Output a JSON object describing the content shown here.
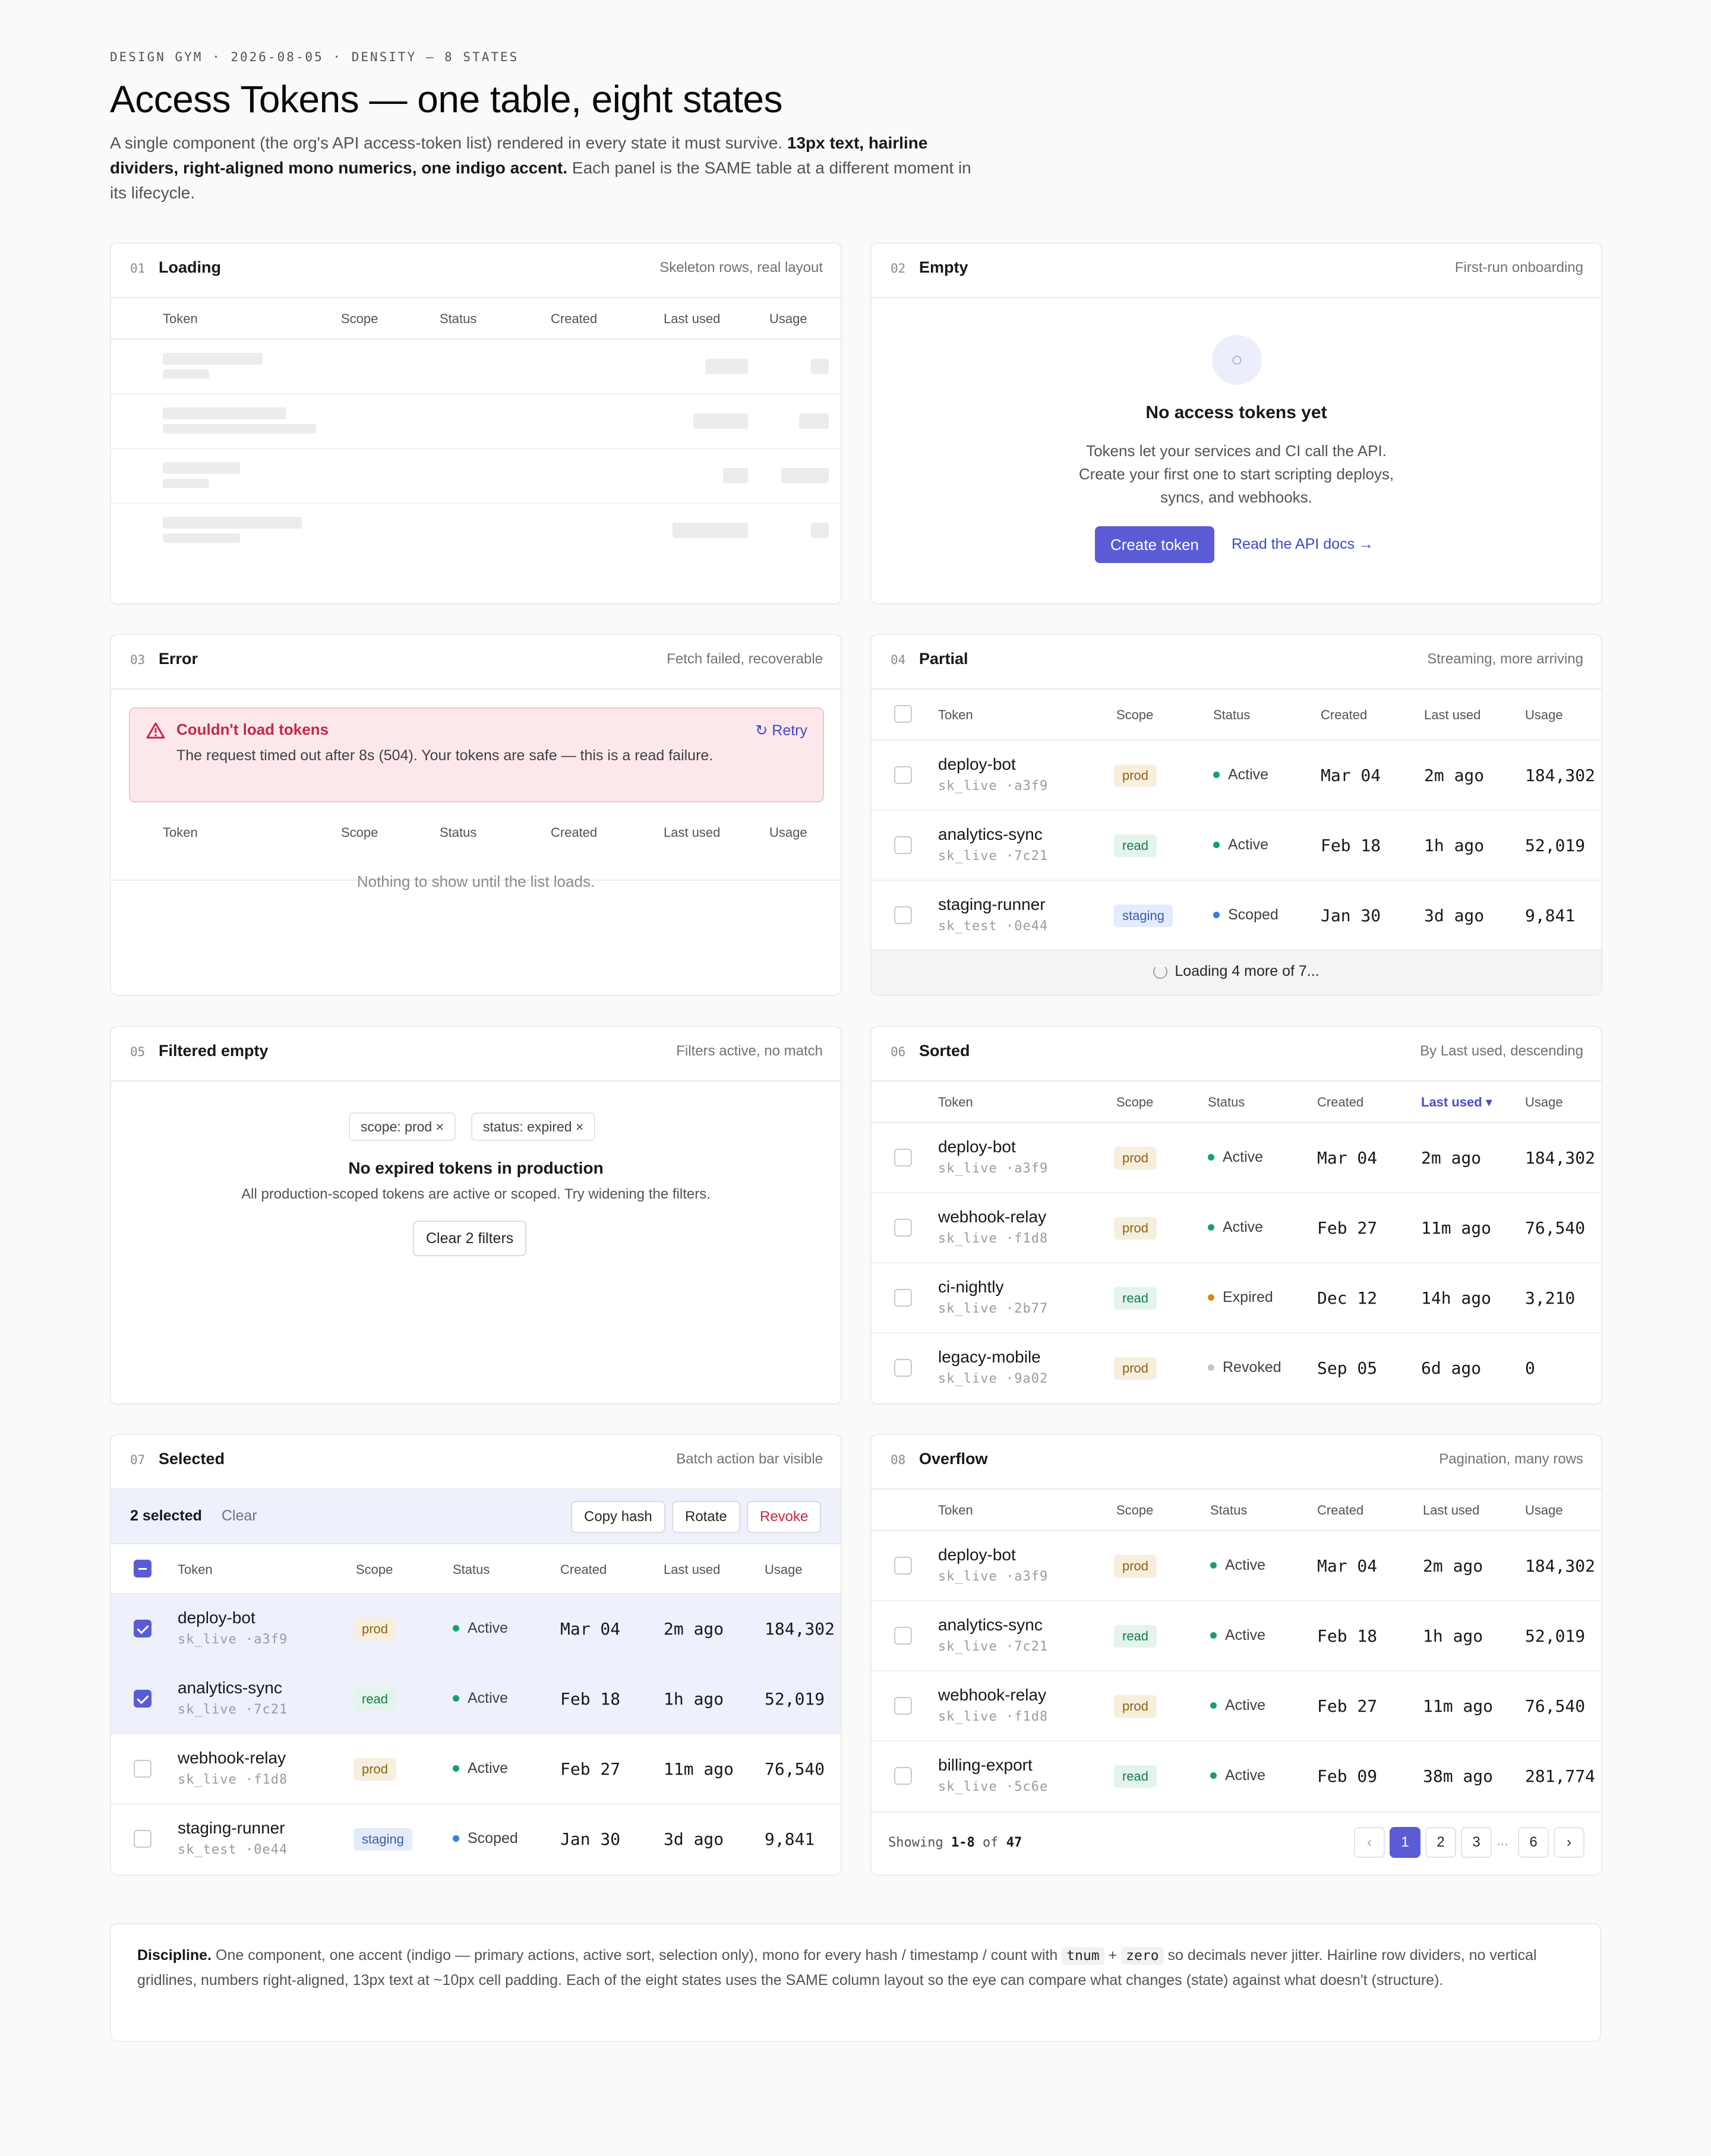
{
  "header": {
    "eyebrow": "DESIGN GYM · 2026-08-05 · DENSITY — 8 STATES",
    "title": "Access Tokens — one table, eight states",
    "intro_a": "A single component (the org's API access-token list) rendered in every state it must survive. ",
    "intro_b": "13px text, hairline dividers, right-aligned mono numerics, one indigo accent.",
    "intro_c": " Each panel is the SAME table at a different moment in its lifecycle."
  },
  "columns": {
    "token": "Token",
    "scope": "Scope",
    "status": "Status",
    "created": "Created",
    "last_used": "Last used",
    "usage": "Usage"
  },
  "panels": {
    "loading": {
      "num": "01",
      "name": "Loading",
      "sub": "Skeleton rows, real layout"
    },
    "empty": {
      "num": "02",
      "name": "Empty",
      "sub": "First-run onboarding",
      "icon": "◌",
      "title": "No access tokens yet",
      "body": [
        "Tokens let your services and CI call the API.",
        "Create your first one to start scripting deploys,",
        "syncs, and webhooks."
      ],
      "cta": "Create token",
      "link": "Read the API docs →"
    },
    "error": {
      "num": "03",
      "name": "Error",
      "sub": "Fetch failed, recoverable",
      "alert_title": "Couldn't load tokens",
      "alert_msg": "The request timed out after 8s (504). Your tokens are safe — this is a read failure.",
      "retry": "↻ Retry",
      "empty_msg": "Nothing to show until the list loads."
    },
    "partial": {
      "num": "04",
      "name": "Partial",
      "sub": "Streaming, more arriving",
      "loading_msg": "Loading 4 more of 7..."
    },
    "filtered": {
      "num": "05",
      "name": "Filtered empty",
      "sub": "Filters active, no match",
      "chips": [
        "scope: prod ×",
        "status: expired ×"
      ],
      "title": "No expired tokens in production",
      "body": "All production-scoped tokens are active or scoped. Try widening the filters.",
      "clear": "Clear 2 filters"
    },
    "sorted": {
      "num": "06",
      "name": "Sorted",
      "sub": "By Last used, descending",
      "sort_label": "Last used ▾"
    },
    "selected": {
      "num": "07",
      "name": "Selected",
      "sub": "Batch action bar visible",
      "count": "2 selected",
      "clear": "Clear",
      "actions": [
        "Copy hash",
        "Rotate",
        "Revoke"
      ]
    },
    "overflow": {
      "num": "08",
      "name": "Overflow",
      "sub": "Pagination, many rows",
      "showing_a": "Showing ",
      "showing_b": "1-8",
      "showing_c": " of ",
      "showing_d": "47",
      "pages": [
        "‹",
        "1",
        "2",
        "3",
        "...",
        "6",
        "›"
      ]
    }
  },
  "rows": {
    "partial": [
      {
        "name": "deploy-bot",
        "key": "sk_live ·a3f9",
        "scope": "prod",
        "status": "Active",
        "created": "Mar 04",
        "last": "2m ago",
        "usage": "184,302"
      },
      {
        "name": "analytics-sync",
        "key": "sk_live ·7c21",
        "scope": "read",
        "status": "Active",
        "created": "Feb 18",
        "last": "1h ago",
        "usage": "52,019"
      },
      {
        "name": "staging-runner",
        "key": "sk_test ·0e44",
        "scope": "staging",
        "status": "Scoped",
        "created": "Jan 30",
        "last": "3d ago",
        "usage": "9,841"
      }
    ],
    "sorted": [
      {
        "name": "deploy-bot",
        "key": "sk_live ·a3f9",
        "scope": "prod",
        "status": "Active",
        "created": "Mar 04",
        "last": "2m ago",
        "usage": "184,302"
      },
      {
        "name": "webhook-relay",
        "key": "sk_live ·f1d8",
        "scope": "prod",
        "status": "Active",
        "created": "Feb 27",
        "last": "11m ago",
        "usage": "76,540"
      },
      {
        "name": "ci-nightly",
        "key": "sk_live ·2b77",
        "scope": "read",
        "status": "Expired",
        "created": "Dec 12",
        "last": "14h ago",
        "usage": "3,210"
      },
      {
        "name": "legacy-mobile",
        "key": "sk_live ·9a02",
        "scope": "prod",
        "status": "Revoked",
        "created": "Sep 05",
        "last": "6d ago",
        "usage": "0"
      }
    ],
    "selected": [
      {
        "name": "deploy-bot",
        "key": "sk_live ·a3f9",
        "scope": "prod",
        "status": "Active",
        "created": "Mar 04",
        "last": "2m ago",
        "usage": "184,302",
        "sel": true
      },
      {
        "name": "analytics-sync",
        "key": "sk_live ·7c21",
        "scope": "read",
        "status": "Active",
        "created": "Feb 18",
        "last": "1h ago",
        "usage": "52,019",
        "sel": true
      },
      {
        "name": "webhook-relay",
        "key": "sk_live ·f1d8",
        "scope": "prod",
        "status": "Active",
        "created": "Feb 27",
        "last": "11m ago",
        "usage": "76,540",
        "sel": false
      },
      {
        "name": "staging-runner",
        "key": "sk_test ·0e44",
        "scope": "staging",
        "status": "Scoped",
        "created": "Jan 30",
        "last": "3d ago",
        "usage": "9,841",
        "sel": false
      }
    ],
    "overflow": [
      {
        "name": "deploy-bot",
        "key": "sk_live ·a3f9",
        "scope": "prod",
        "status": "Active",
        "created": "Mar 04",
        "last": "2m ago",
        "usage": "184,302"
      },
      {
        "name": "analytics-sync",
        "key": "sk_live ·7c21",
        "scope": "read",
        "status": "Active",
        "created": "Feb 18",
        "last": "1h ago",
        "usage": "52,019"
      },
      {
        "name": "webhook-relay",
        "key": "sk_live ·f1d8",
        "scope": "prod",
        "status": "Active",
        "created": "Feb 27",
        "last": "11m ago",
        "usage": "76,540"
      },
      {
        "name": "billing-export",
        "key": "sk_live ·5c6e",
        "scope": "read",
        "status": "Active",
        "created": "Feb 09",
        "last": "38m ago",
        "usage": "281,774"
      }
    ]
  },
  "discipline": {
    "lead": "Discipline.",
    "a": " One component, one accent (indigo — primary actions, active sort, selection only), mono for every hash / timestamp / count with ",
    "k1": "tnum",
    "plus": " + ",
    "k2": "zero",
    "b": " so decimals never jitter. Hairline row dividers, no vertical gridlines, numbers right-aligned, 13px text at ~10px cell padding. Each of the eight states uses the SAME column layout so the eye can compare what changes (state) against what doesn't (structure)."
  },
  "colors": {
    "accent": "#5b5bd6",
    "active": "#17a06a",
    "scoped": "#3d7be0",
    "expired": "#d38a1d",
    "revoked": "#c4c4ca",
    "error": "#c2284a"
  }
}
